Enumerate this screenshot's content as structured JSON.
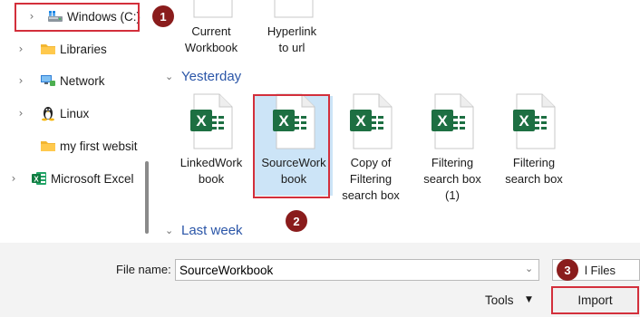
{
  "nav": {
    "items": [
      {
        "label": "Windows (C:)",
        "icon": "drive-icon",
        "has_chevron": true
      },
      {
        "label": "Libraries",
        "icon": "folder-icon",
        "has_chevron": true
      },
      {
        "label": "Network",
        "icon": "network-icon",
        "has_chevron": true
      },
      {
        "label": "Linux",
        "icon": "linux-icon",
        "has_chevron": true
      },
      {
        "label": "my first websit",
        "icon": "folder-icon",
        "has_chevron": false
      },
      {
        "label": "Microsoft Excel",
        "icon": "excel-icon",
        "has_chevron": true
      }
    ]
  },
  "content": {
    "top_files": [
      {
        "label_line1": "Current",
        "label_line2": "Workbook"
      },
      {
        "label_line1": "Hyperlink",
        "label_line2": "to url"
      }
    ],
    "groups": [
      {
        "label": "Yesterday"
      },
      {
        "label": "Last week"
      }
    ],
    "yesterday_files": [
      {
        "lines": [
          "LinkedWork",
          "book"
        ],
        "selected": false
      },
      {
        "lines": [
          "SourceWork",
          "book"
        ],
        "selected": true
      },
      {
        "lines": [
          "Copy of",
          "Filtering",
          "search box"
        ],
        "selected": false
      },
      {
        "lines": [
          "Filtering",
          "search box",
          "(1)"
        ],
        "selected": false
      },
      {
        "lines": [
          "Filtering",
          "search box"
        ],
        "selected": false
      }
    ],
    "excel_letter": "X"
  },
  "bottom": {
    "file_name_label": "File name:",
    "file_name_value": "SourceWorkbook",
    "file_type_value": "l Files",
    "tools_label": "Tools",
    "import_label": "Import"
  },
  "callouts": [
    "1",
    "2",
    "3"
  ],
  "colors": {
    "excel_green": "#1d6f42",
    "highlight_red": "#d32f3b",
    "badge": "#8a1c1c",
    "group_blue": "#2b56a8",
    "selection": "#cce4f7"
  }
}
